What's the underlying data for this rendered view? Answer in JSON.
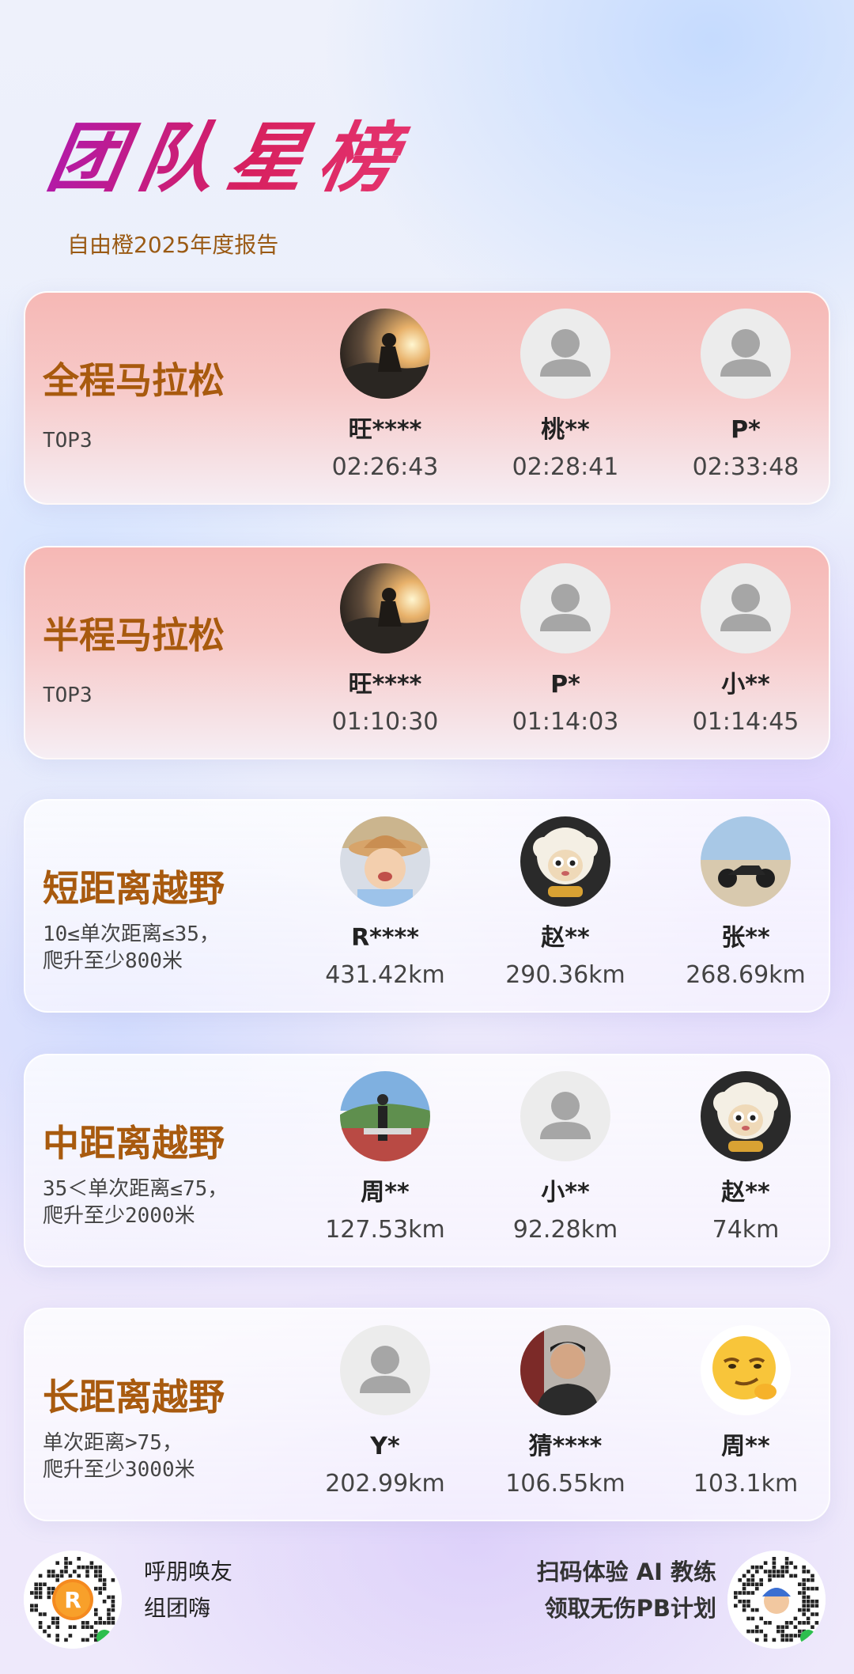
{
  "header": {
    "title": "团队星榜",
    "subtitle": "自由橙2025年度报告"
  },
  "cards": [
    {
      "title": "全程马拉松",
      "desc": [
        "TOP3"
      ],
      "entries": [
        {
          "name": "旺****",
          "value": "02:26:43",
          "avatar": "sunset-photo"
        },
        {
          "name": "桃**",
          "value": "02:28:41",
          "avatar": "default-person-icon"
        },
        {
          "name": "P*",
          "value": "02:33:48",
          "avatar": "default-person-icon"
        }
      ]
    },
    {
      "title": "半程马拉松",
      "desc": [
        "TOP3"
      ],
      "entries": [
        {
          "name": "旺****",
          "value": "01:10:30",
          "avatar": "sunset-photo"
        },
        {
          "name": "P*",
          "value": "01:14:03",
          "avatar": "default-person-icon"
        },
        {
          "name": "小**",
          "value": "01:14:45",
          "avatar": "default-person-icon"
        }
      ]
    },
    {
      "title": "短距离越野",
      "desc": [
        "10≤单次距离≤35，",
        "爬升至少800米"
      ],
      "entries": [
        {
          "name": "R****",
          "value": "431.42km",
          "avatar": "baby-hat-photo"
        },
        {
          "name": "赵**",
          "value": "290.36km",
          "avatar": "sheep-cartoon"
        },
        {
          "name": "张**",
          "value": "268.69km",
          "avatar": "motorcycle-beach-photo"
        }
      ]
    },
    {
      "title": "中距离越野",
      "desc": [
        "35＜单次距离≤75，",
        "爬升至少2000米"
      ],
      "entries": [
        {
          "name": "周**",
          "value": "127.53km",
          "avatar": "person-landscape-photo"
        },
        {
          "name": "小**",
          "value": "92.28km",
          "avatar": "default-person-icon"
        },
        {
          "name": "赵**",
          "value": "74km",
          "avatar": "sheep-cartoon"
        }
      ]
    },
    {
      "title": "长距离越野",
      "desc": [
        "单次距离>75，",
        "爬升至少3000米"
      ],
      "entries": [
        {
          "name": "Y*",
          "value": "202.99km",
          "avatar": "default-person-icon"
        },
        {
          "name": "猜****",
          "value": "106.55km",
          "avatar": "man-portrait-photo"
        },
        {
          "name": "周**",
          "value": "103.1km",
          "avatar": "smirk-emoji"
        }
      ]
    }
  ],
  "footer": {
    "left_lines": [
      "呼朋唤友",
      "组团嗨"
    ],
    "right_lines": [
      "扫码体验 AI 教练",
      "领取无伤PB计划"
    ],
    "left_qr": "miniprogram-qr-code-logo",
    "right_qr": "miniprogram-qr-code-avatar"
  },
  "colors": {
    "title_gradient_start": "#b21aa8",
    "title_gradient_end": "#e5356e",
    "accent_brown": "#a85a0e",
    "pink_card": "#f6b8b5"
  }
}
